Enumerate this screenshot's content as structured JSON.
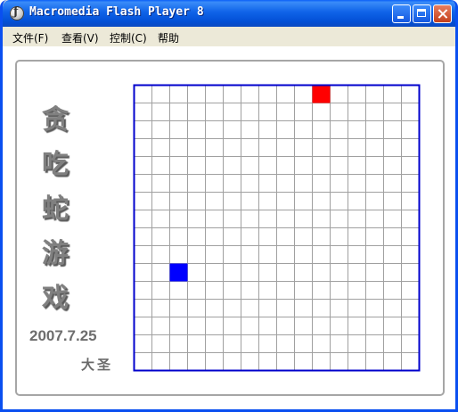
{
  "window": {
    "title": "Macromedia Flash Player 8"
  },
  "menu": [
    "文件(F)",
    "查看(V)",
    "控制(C)",
    "帮助"
  ],
  "game": {
    "title_chars": [
      "贪",
      "吃",
      "蛇",
      "游",
      "戏"
    ],
    "date": "2007.7.25",
    "author": "大圣",
    "grid": {
      "cols": 16,
      "rows": 16
    },
    "food": {
      "col": 10,
      "row": 0,
      "color": "#ff0000"
    },
    "snake": [
      {
        "col": 2,
        "row": 10
      }
    ],
    "snake_color": "#0000ff",
    "border_color": "#0000cc",
    "grid_color": "#a0a0a0"
  }
}
